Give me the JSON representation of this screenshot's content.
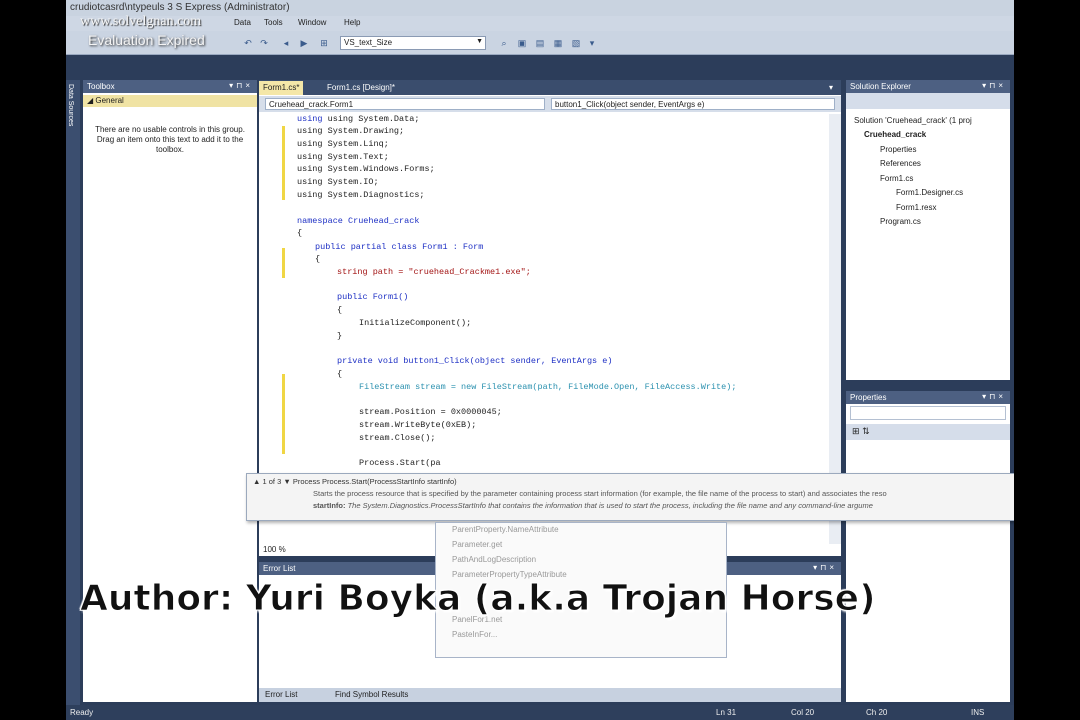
{
  "title_text": "crudiotcasrd\\ntypeuls 3  S Express (Administrator)",
  "watermark": {
    "site": "www.solvelgnan.com",
    "status": "Evaluation Expired"
  },
  "menu": {
    "items": [
      "Data",
      "Tools",
      "Window",
      "Help"
    ]
  },
  "toolbar": {
    "config_value": "VS_text_Size"
  },
  "side_strip": {
    "label": "Data Sources"
  },
  "toolbox": {
    "title": "Toolbox",
    "group": "◢ General",
    "empty_text": "There are no usable controls in this group. Drag an item onto this text to add it to the toolbox."
  },
  "editor": {
    "tabs": [
      "Form1.cs*",
      "Form1.cs [Design]*"
    ],
    "nav_left": "Cruehead_crack.Form1",
    "nav_right": "button1_Click(object sender, EventArgs e)",
    "zoom": "100 %"
  },
  "code": {
    "lines": [
      [
        "using System.Data;"
      ],
      [
        "using System.Drawing;"
      ],
      [
        "using System.Linq;"
      ],
      [
        "using System.Text;"
      ],
      [
        "using System.Windows.Forms;"
      ],
      [
        "using System.IO;"
      ],
      [
        "using System.Diagnostics;"
      ],
      [
        "namespace Cruehead_crack"
      ],
      [
        "{"
      ],
      [
        "public partial class Form1 : Form"
      ],
      [
        "{"
      ],
      [
        "string path = \"cruehead_Crackme1.exe\";"
      ],
      [
        "public Form1()"
      ],
      [
        "{"
      ],
      [
        "InitializeComponent();"
      ],
      [
        "}"
      ],
      [
        "private void button1_Click(object sender, EventArgs e)"
      ],
      [
        "{"
      ],
      [
        "FileStream stream = new FileStream(path, FileMode.Open, FileAccess.Write);"
      ],
      [
        "stream.Position = 0x0000045;"
      ],
      [
        "stream.WriteByte(0xEB);"
      ],
      [
        "stream.Close();"
      ],
      [
        "Process.Start(pa"
      ]
    ]
  },
  "tooltip": {
    "counter": "▲ 1 of 3 ▼",
    "signature": "Process Process.Start(ProcessStartInfo startInfo)",
    "summary": "Starts the process resource that is specified by the parameter containing process start information (for example, the file name of the process to start) and associates the reso",
    "param": "startInfo:",
    "param_desc": "The System.Diagnostics.ProcessStartInfo that contains the information that is used to start the process, including the file name and any command-line argume"
  },
  "intellisense": {
    "items": [
      "ParentProperty.NameAttribute",
      "Parameter.get",
      "PathAndLogDescription",
      "ParameterPropertyTypeAttribute",
      "",
      "",
      "PanelFor1.net",
      "PasteInFor..."
    ]
  },
  "error_list": {
    "title": "Error List",
    "tabs": [
      "Error List",
      "Find Symbol Results"
    ]
  },
  "solution_explorer": {
    "title": "Solution Explorer",
    "items": [
      "Solution 'Cruehead_crack' (1 proj",
      "Cruehead_crack",
      "Properties",
      "References",
      "Form1.cs",
      "Form1.Designer.cs",
      "Form1.resx",
      "Program.cs"
    ]
  },
  "properties": {
    "title": "Properties"
  },
  "status": {
    "ready": "Ready",
    "line": "Ln 31",
    "col": "Col 20",
    "ch": "Ch 20",
    "ins": "INS"
  },
  "author_caption": "Author: Yuri Boyka (a.k.a Trojan Horse)"
}
